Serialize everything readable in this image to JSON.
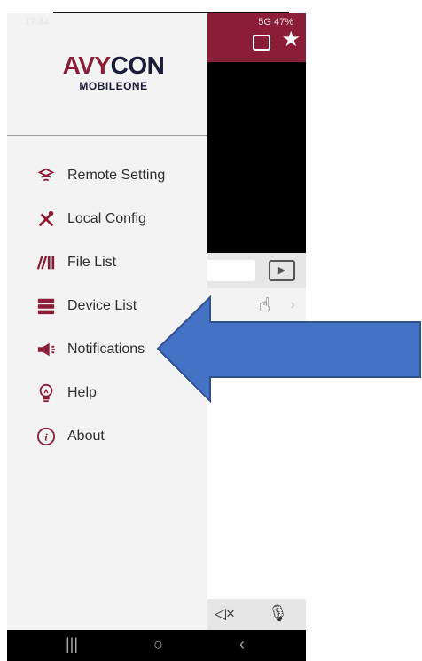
{
  "status_bar": {
    "time": "17:44",
    "indicators": "5G 47%"
  },
  "app": {
    "colors": {
      "brand": "#8b1d36",
      "navy": "#1b1b3a",
      "arrow": "#4472c4"
    }
  },
  "logo": {
    "brand": "AVYCON",
    "sub": "MOBILEONE"
  },
  "menu": {
    "items": [
      {
        "label": "Remote Setting",
        "icon": "remote-setting-icon"
      },
      {
        "label": "Local Config",
        "icon": "tools-icon"
      },
      {
        "label": "File List",
        "icon": "file-list-icon"
      },
      {
        "label": "Device List",
        "icon": "device-list-icon"
      },
      {
        "label": "Notifications",
        "icon": "megaphone-icon"
      },
      {
        "label": "Help",
        "icon": "lightbulb-icon"
      },
      {
        "label": "About",
        "icon": "info-icon"
      }
    ]
  }
}
